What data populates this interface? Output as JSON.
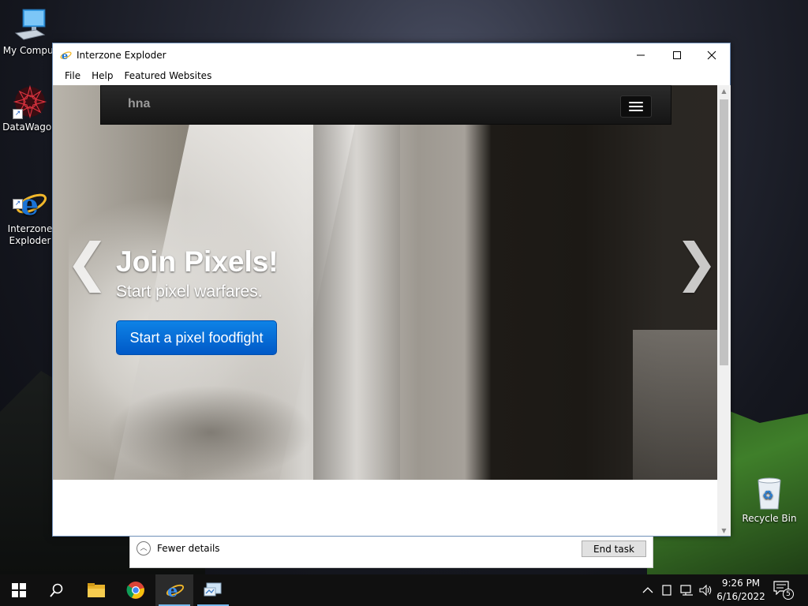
{
  "desktop": {
    "icons": [
      {
        "label": "My Comput",
        "icon": "computer-icon"
      },
      {
        "label": "DataWagon",
        "icon": "datawagon-icon"
      },
      {
        "label": "Interzone\nExploder",
        "icon": "browser-icon"
      },
      {
        "label": "Recycle Bin",
        "icon": "recycle-bin-icon"
      }
    ]
  },
  "window": {
    "title": "Interzone Exploder",
    "controls": {
      "minimize": "—",
      "maximize": "☐",
      "close": "✕"
    },
    "menu": [
      "File",
      "Help",
      "Featured Websites"
    ]
  },
  "site": {
    "brand": "hna",
    "hero": {
      "title": "Join Pixels!",
      "subtitle": "Start pixel warfares.",
      "button": "Start a pixel foodfight",
      "prev": "❮",
      "next": "❯"
    }
  },
  "task_manager": {
    "fewer_details": "Fewer details",
    "end_task": "End task"
  },
  "taskbar": {
    "items": [
      "start-icon",
      "search-icon",
      "file-explorer-icon",
      "chrome-icon",
      "browser-icon",
      "network-app-icon"
    ],
    "time": "9:26 PM",
    "date": "6/16/2022",
    "notification_count": "5"
  },
  "colors": {
    "accent_button": "#0a6fd8",
    "taskbar": "#101010",
    "active_underline": "#76b9ed"
  }
}
